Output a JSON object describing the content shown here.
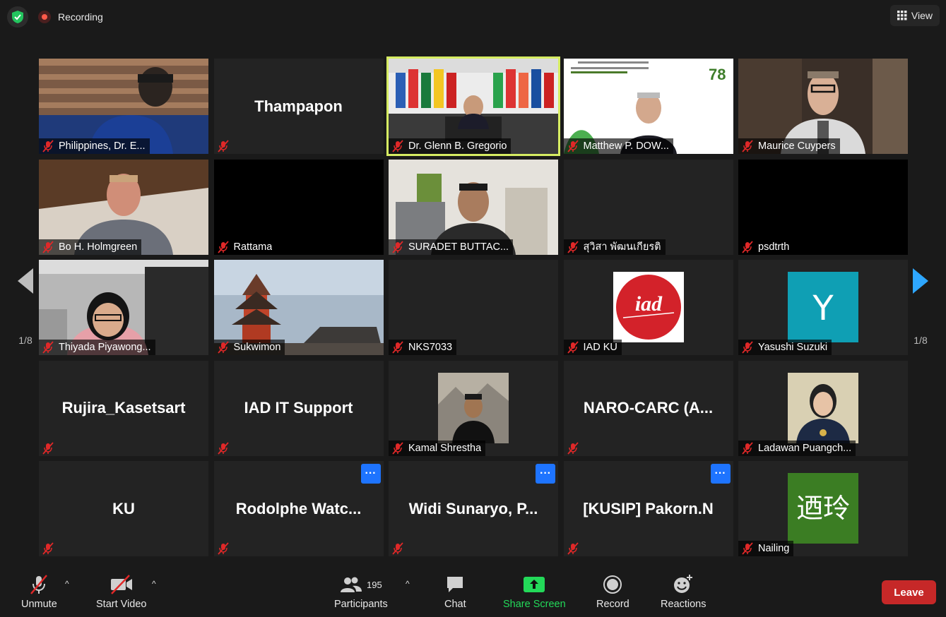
{
  "top_bar": {
    "recording_label": "Recording",
    "view_label": "View"
  },
  "paging": {
    "left_label": "1/8",
    "right_label": "1/8"
  },
  "tiles": [
    {
      "name": "Philippines, Dr. E...",
      "type": "video",
      "scene": "person-blue"
    },
    {
      "name": "Thampapon",
      "type": "name"
    },
    {
      "name": "Dr. Glenn B. Gregorio",
      "type": "video",
      "scene": "flags",
      "active_speaker": true
    },
    {
      "name": "Matthew P. DOW...",
      "type": "video",
      "scene": "banner"
    },
    {
      "name": "Maurice Cuypers",
      "type": "video",
      "scene": "person-glasses"
    },
    {
      "name": "Bo H. Holmgreen",
      "type": "video",
      "scene": "person-room"
    },
    {
      "name": "Rattama",
      "type": "black"
    },
    {
      "name": "SURADET BUTTAC...",
      "type": "video",
      "scene": "person-office"
    },
    {
      "name": "สุวิสา  พัฒนเกียรติ",
      "type": "empty"
    },
    {
      "name": "psdtrth",
      "type": "black"
    },
    {
      "name": "Thiyada Piyawong...",
      "type": "video",
      "scene": "person-girl"
    },
    {
      "name": "Sukwimon",
      "type": "video",
      "scene": "pagoda"
    },
    {
      "name": "NKS7033",
      "type": "empty"
    },
    {
      "name": "IAD KU",
      "type": "avatar",
      "avatar": "iad-logo"
    },
    {
      "name": "Yasushi Suzuki",
      "type": "avatar",
      "avatar": "letter",
      "letter": "Y",
      "color": "#0f9fb4"
    },
    {
      "name": "Rujira_Kasetsart",
      "type": "name",
      "big": "Rujira_Kasetsart"
    },
    {
      "name": "IAD IT Support",
      "type": "name",
      "big": "IAD IT Support"
    },
    {
      "name": "Kamal Shrestha",
      "type": "avatar",
      "avatar": "photo-mountain"
    },
    {
      "name": "NARO-CARC (A...",
      "type": "name",
      "big": "NARO-CARC  (A..."
    },
    {
      "name": "Ladawan Puangch...",
      "type": "avatar",
      "avatar": "photo-woman"
    },
    {
      "name": "KU",
      "type": "name",
      "big": "KU"
    },
    {
      "name": "Rodolphe Watc...",
      "type": "name",
      "big": "Rodolphe  Watc...",
      "more": true
    },
    {
      "name": "Widi Sunaryo, P...",
      "type": "name",
      "big": "Widi Sunaryo, P...",
      "more": true
    },
    {
      "name": "[KUSIP] Pakorn.N",
      "type": "name",
      "big": "[KUSIP] Pakorn.N",
      "more": true
    },
    {
      "name": "Nailing",
      "type": "avatar",
      "avatar": "letter",
      "letter": "迺玲",
      "color": "#3b7d23"
    }
  ],
  "toolbar": {
    "unmute_label": "Unmute",
    "start_video_label": "Start Video",
    "participants_label": "Participants",
    "participants_count": "195",
    "chat_label": "Chat",
    "share_screen_label": "Share Screen",
    "record_label": "Record",
    "reactions_label": "Reactions",
    "leave_label": "Leave"
  },
  "colors": {
    "active_speaker_border": "#d6ec62",
    "share_green": "#23d959",
    "leave_red": "#c62828",
    "more_blue": "#1e74ff",
    "mic_off_red": "#e02828"
  }
}
